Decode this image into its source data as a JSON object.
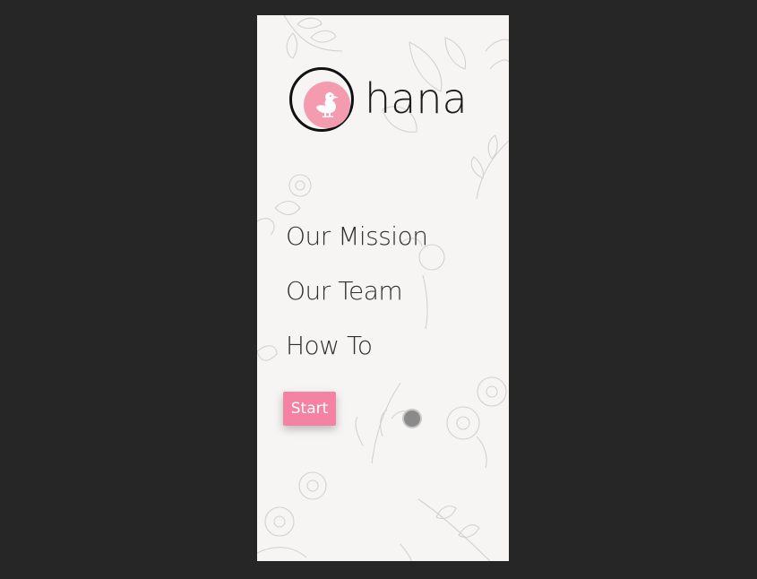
{
  "logo": {
    "text": "hana",
    "brand_color": "#f59bb0",
    "icon": "duck-icon"
  },
  "nav": {
    "items": [
      {
        "label": "Our Mission"
      },
      {
        "label": "Our Team"
      },
      {
        "label": "How To"
      }
    ]
  },
  "start_button": {
    "label": "Start",
    "color": "#f382a3"
  },
  "indicator": {
    "icon": "circle-dot-icon",
    "color": "#8a8a8a"
  },
  "background": {
    "page": "#262626",
    "panel": "#f6f5f3",
    "decoration": "floral-line-art"
  }
}
